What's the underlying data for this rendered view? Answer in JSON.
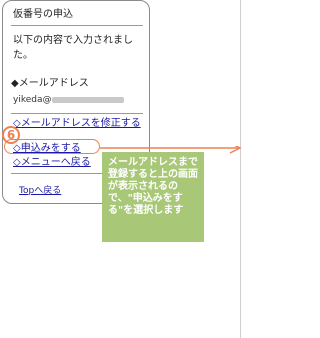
{
  "screen": {
    "title": "仮番号の申込",
    "instruction": "以下の内容で入力されました。",
    "email_label": "◆メールアドレス",
    "email_value_visible": "yikeda@"
  },
  "links": [
    {
      "label": "◇メールアドレスを修正する"
    },
    {
      "label": "◇申込みをする"
    },
    {
      "label": "◇メニューへ戻る"
    },
    {
      "label": "Topへ戻る"
    }
  ],
  "annotation": {
    "step_number": "6",
    "note_text": "メールアドレスまで登録すると上の画面が表示されるので、\"申込みをする\"を選択します",
    "accent_color": "#f08050",
    "note_color": "#a8c878"
  }
}
